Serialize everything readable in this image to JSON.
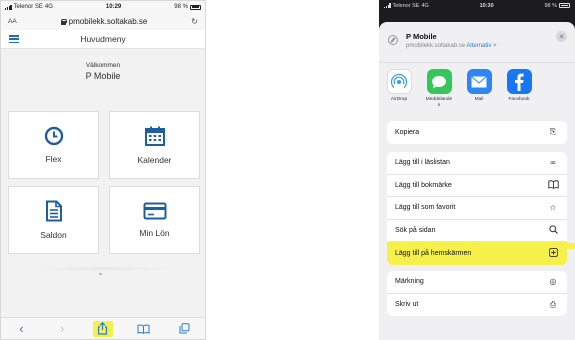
{
  "left": {
    "status": {
      "carrier": "Telenor SE",
      "network": "4G",
      "time": "10:29",
      "battery": "98 %"
    },
    "browser": {
      "aa": "AA",
      "url": "pmobilekk.soltakab.se",
      "reload_glyph": "↻"
    },
    "header": {
      "title": "Huvudmeny"
    },
    "welcome": {
      "greeting": "Välkommen",
      "name": "P Mobile"
    },
    "tiles": [
      {
        "label": "Flex",
        "icon": "clock-icon"
      },
      {
        "label": "Kalender",
        "icon": "calendar-icon"
      },
      {
        "label": "Saldon",
        "icon": "document-icon"
      },
      {
        "label": "Min Lön",
        "icon": "credit-card-icon"
      }
    ],
    "toolbar": {
      "back": "‹",
      "forward": "›",
      "bookmarks": "□□",
      "tabs": "❐"
    }
  },
  "right": {
    "status": {
      "carrier": "Telenor SE",
      "network": "4G",
      "time": "10:30",
      "battery": "98 %"
    },
    "sheet": {
      "title": "P Mobile",
      "url": "pmobilekk.soltakab.se",
      "alternatives": "Alternativ >",
      "close": "✕"
    },
    "apps": [
      {
        "label": "AirDrop",
        "color": "#2f9cf4"
      },
      {
        "label": "Meddelande n",
        "color": "#35c759"
      },
      {
        "label": "Mail",
        "color": "#2e86f5"
      },
      {
        "label": "Facebook",
        "color": "#1877f2"
      }
    ],
    "actions_top": [
      {
        "label": "Kopiera",
        "icon": "⎘"
      }
    ],
    "actions_mid": [
      {
        "label": "Lägg till i läslistan",
        "icon": "∞"
      },
      {
        "label": "Lägg till bokmärke",
        "icon": "📖"
      },
      {
        "label": "Lägg till som favorit",
        "icon": "☆"
      },
      {
        "label": "Sök på sidan",
        "icon": "⚲"
      },
      {
        "label": "Lägg till på hemskärmen",
        "icon": "⊞"
      }
    ],
    "actions_bottom": [
      {
        "label": "Märkning",
        "icon": "◎"
      },
      {
        "label": "Skriv ut",
        "icon": "⎙"
      }
    ],
    "highlight_color": "#f5f04a"
  }
}
